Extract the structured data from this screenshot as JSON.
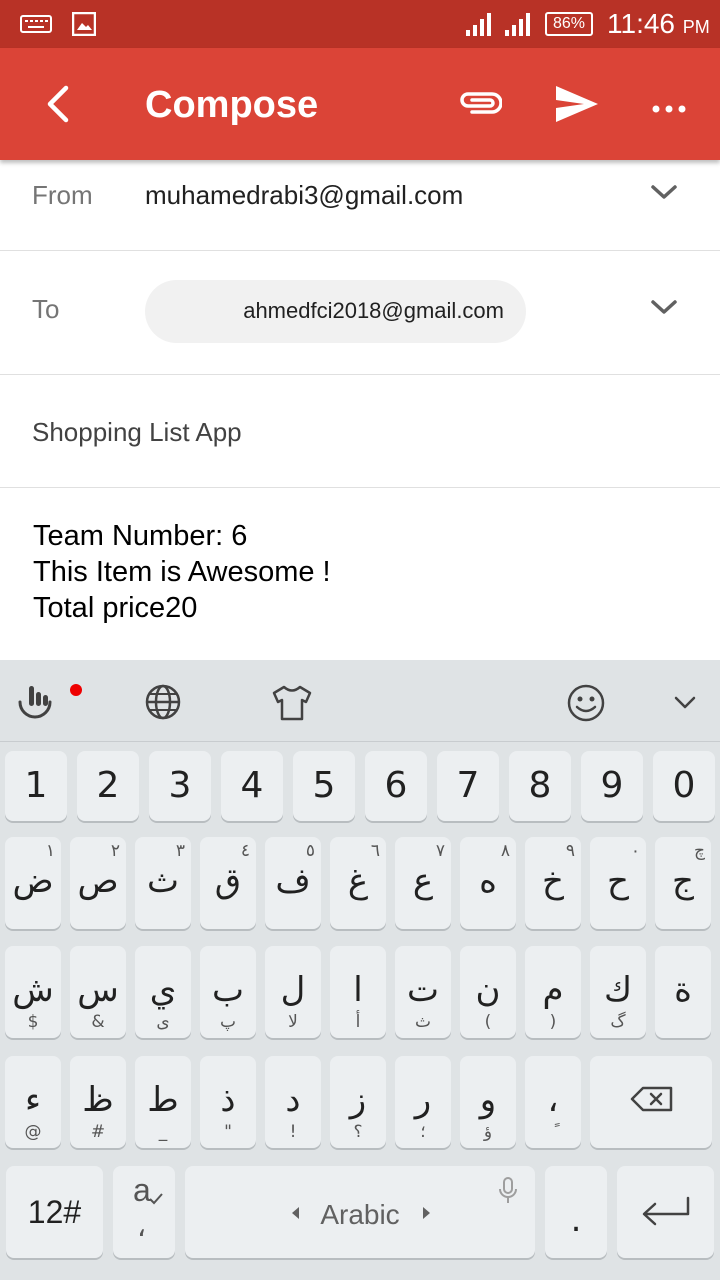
{
  "status_bar": {
    "battery": "86%",
    "time": "11:46",
    "ampm": "PM",
    "icons": [
      "keyboard-icon",
      "image-icon",
      "signal-icon",
      "signal-icon",
      "battery-icon"
    ]
  },
  "app_bar": {
    "title": "Compose",
    "icons": [
      "back-arrow-icon",
      "attach-icon",
      "send-icon",
      "more-vert-icon"
    ],
    "color": "#db4437"
  },
  "form": {
    "from_label": "From",
    "from_value": "muhamedrabi3@gmail.com",
    "to_label": "To",
    "to_chip": "ahmedfci2018@gmail.com",
    "subject": "Shopping List App",
    "body_lines": [
      "Team Number: 6",
      "This Item is Awesome !",
      "Total price20"
    ]
  },
  "keyboard": {
    "toolbar_icons": [
      "touchpal-icon",
      "globe-icon",
      "theme-shirt-icon",
      "emoji-icon",
      "collapse-chevron-icon"
    ],
    "number_row": [
      "1",
      "2",
      "3",
      "4",
      "5",
      "6",
      "7",
      "8",
      "9",
      "0"
    ],
    "row1": [
      {
        "main": "ض",
        "sub": "١"
      },
      {
        "main": "ص",
        "sub": "٢"
      },
      {
        "main": "ث",
        "sub": "٣"
      },
      {
        "main": "ق",
        "sub": "٤"
      },
      {
        "main": "ف",
        "sub": "٥"
      },
      {
        "main": "غ",
        "sub": "٦"
      },
      {
        "main": "ع",
        "sub": "٧"
      },
      {
        "main": "ه",
        "sub": "٨"
      },
      {
        "main": "خ",
        "sub": "٩"
      },
      {
        "main": "ح",
        "sub": "٠"
      },
      {
        "main": "ج",
        "sub": "چ"
      }
    ],
    "row2": [
      {
        "main": "ش",
        "sub": "$"
      },
      {
        "main": "س",
        "sub": "&"
      },
      {
        "main": "ي",
        "sub": "ى"
      },
      {
        "main": "ب",
        "sub": "پ"
      },
      {
        "main": "ل",
        "sub": "لا"
      },
      {
        "main": "ا",
        "sub": "أ"
      },
      {
        "main": "ت",
        "sub": "ث"
      },
      {
        "main": "ن",
        "sub": "("
      },
      {
        "main": "م",
        "sub": ")"
      },
      {
        "main": "ك",
        "sub": "گ"
      },
      {
        "main": "ة",
        "sub": ""
      }
    ],
    "row3": [
      {
        "main": "ء",
        "sub": "@"
      },
      {
        "main": "ظ",
        "sub": "#"
      },
      {
        "main": "ط",
        "sub": "_"
      },
      {
        "main": "ذ",
        "sub": "\""
      },
      {
        "main": "د",
        "sub": "!"
      },
      {
        "main": "ز",
        "sub": "؟"
      },
      {
        "main": "ر",
        "sub": "؛"
      },
      {
        "main": "و",
        "sub": "ؤ"
      },
      {
        "main": "،",
        "sub": "ً"
      }
    ],
    "sym_key": "12#",
    "lang_key_glyph": "a",
    "lang_key_sub": "،",
    "space_label": "Arabic",
    "period_key": ".",
    "accent": "#db4437"
  }
}
